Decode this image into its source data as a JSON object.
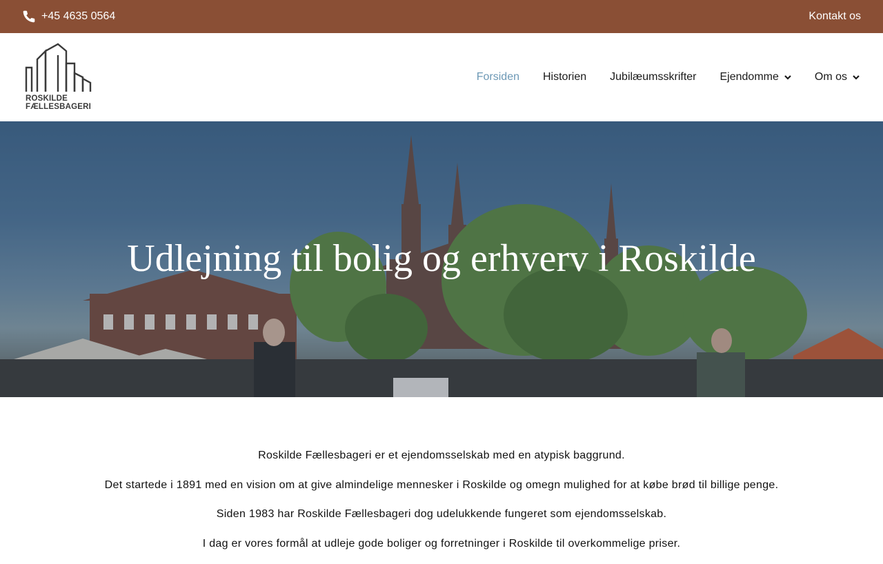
{
  "topbar": {
    "phone": "+45 4635 0564",
    "contact": "Kontakt os"
  },
  "logo": {
    "line1": "ROSKILDE",
    "line2": "FÆLLESBAGERI"
  },
  "nav": {
    "items": [
      {
        "label": "Forsiden",
        "active": true
      },
      {
        "label": "Historien"
      },
      {
        "label": "Jubilæumsskrifter"
      },
      {
        "label": "Ejendomme",
        "dropdown": true
      },
      {
        "label": "Om os",
        "dropdown": true
      }
    ]
  },
  "hero": {
    "title": "Udlejning til bolig og erhverv i Roskilde"
  },
  "intro": {
    "paragraphs": [
      "Roskilde Fællesbageri er et ejendomsselskab med en atypisk baggrund.",
      "Det startede i 1891 med en vision om at give almindelige mennesker i Roskilde og omegn mulighed for at købe brød til billige penge.",
      "Siden 1983 har Roskilde Fællesbageri dog udelukkende fungeret som ejendomsselskab.",
      "I dag er vores formål at udleje gode boliger og forretninger i Roskilde til overkommelige priser."
    ]
  },
  "colors": {
    "topbar": "#8a4f35",
    "nav_active": "#6c98b5",
    "text": "#1a1a1a"
  },
  "icons": {
    "phone": "phone-icon",
    "dropdown": "chevron-down-icon"
  }
}
